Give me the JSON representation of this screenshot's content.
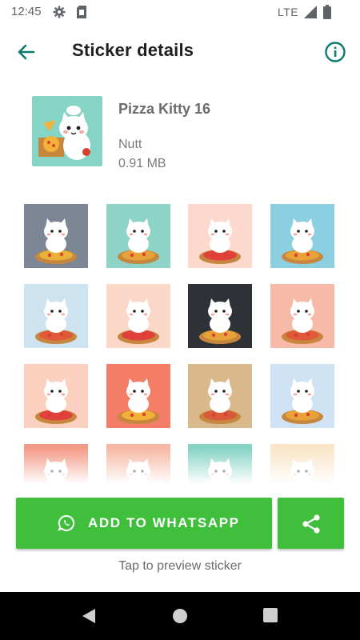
{
  "status_bar": {
    "time": "12:45",
    "network": "LTE",
    "icons": [
      "gear-icon",
      "sim-card-icon",
      "signal-icon",
      "battery-icon"
    ]
  },
  "app_bar": {
    "title": "Sticker details",
    "back_icon": "arrow-back-icon",
    "info_icon": "info-icon"
  },
  "pack": {
    "name": "Pizza Kitty 16",
    "author": "Nutt",
    "size": "0.91 MB",
    "tray_background": "#86d4c5"
  },
  "stickers": [
    {
      "bg": "#7c8695",
      "accent": "#e8b13a"
    },
    {
      "bg": "#8ed3c8",
      "accent": "#e8a23a"
    },
    {
      "bg": "#fcd9cc",
      "accent": "#e0413a"
    },
    {
      "bg": "#8ccfe1",
      "accent": "#e8a23a"
    },
    {
      "bg": "#cde3f0",
      "accent": "#e05a3a"
    },
    {
      "bg": "#fbd7c7",
      "accent": "#e0413a"
    },
    {
      "bg": "#2e3136",
      "accent": "#e8a23a"
    },
    {
      "bg": "#f7b9a8",
      "accent": "#e05a3a"
    },
    {
      "bg": "#fcd0bf",
      "accent": "#e0413a"
    },
    {
      "bg": "#f37d67",
      "accent": "#f2b23a"
    },
    {
      "bg": "#d9b98c",
      "accent": "#d85a3a"
    },
    {
      "bg": "#cfe3f5",
      "accent": "#e8a23a"
    },
    {
      "bg": "#f39a86",
      "accent": "#f2b23a"
    },
    {
      "bg": "#f6b8a3",
      "accent": "#e8a23a"
    },
    {
      "bg": "#86d4c5",
      "accent": "#e0413a"
    },
    {
      "bg": "#fae5c8",
      "accent": "#e8a23a"
    }
  ],
  "actions": {
    "add_label": "ADD TO WHATSAPP",
    "share_icon": "share-icon",
    "hint": "Tap to preview sticker",
    "primary_color": "#3fbf3c"
  },
  "nav": {
    "icons": [
      "back-triangle-icon",
      "home-circle-icon",
      "recents-square-icon"
    ]
  }
}
